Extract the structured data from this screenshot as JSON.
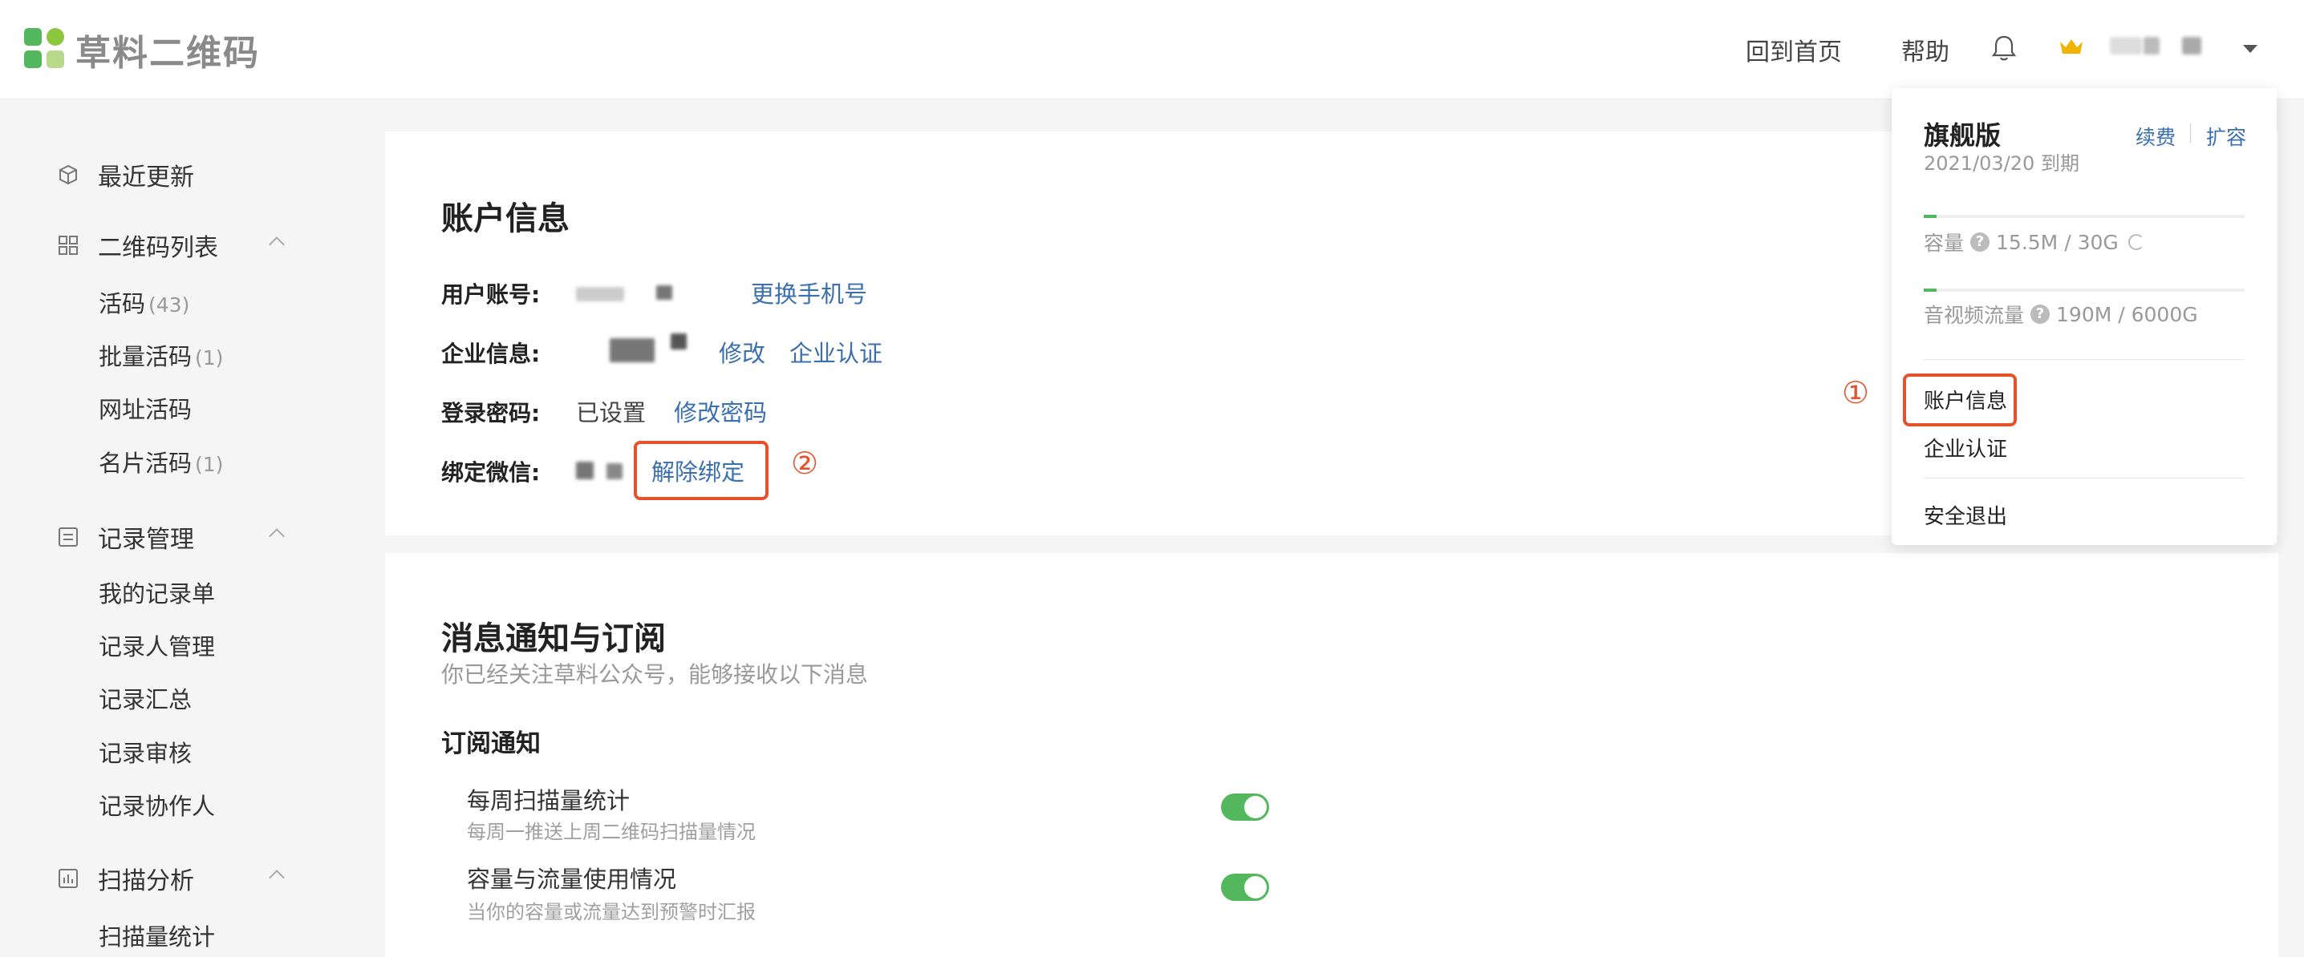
{
  "header": {
    "logo_text": "草料二维码",
    "nav": [
      "回到首页",
      "帮助"
    ],
    "icons": [
      "bell-icon",
      "crown-icon",
      "caret-down-icon"
    ]
  },
  "sidebar": {
    "groups": [
      {
        "label": "最近更新",
        "icon": "cube-icon"
      },
      {
        "label": "二维码列表",
        "icon": "grid-icon",
        "items": [
          {
            "label": "活码",
            "count": "(43)"
          },
          {
            "label": "批量活码",
            "count": "(1)"
          },
          {
            "label": "网址活码",
            "count": ""
          },
          {
            "label": "名片活码",
            "count": "(1)"
          }
        ]
      },
      {
        "label": "记录管理",
        "icon": "form-icon",
        "items": [
          {
            "label": "我的记录单"
          },
          {
            "label": "记录人管理"
          },
          {
            "label": "记录汇总"
          },
          {
            "label": "记录审核"
          },
          {
            "label": "记录协作人"
          }
        ]
      },
      {
        "label": "扫描分析",
        "icon": "chart-icon",
        "items": [
          {
            "label": "扫描量统计"
          }
        ]
      }
    ]
  },
  "account": {
    "title": "账户信息",
    "rows": [
      {
        "label": "用户账号:",
        "value": "",
        "actions": [
          "更换手机号"
        ]
      },
      {
        "label": "企业信息:",
        "value": "",
        "actions": [
          "修改",
          "企业认证"
        ]
      },
      {
        "label": "登录密码:",
        "value": "已设置",
        "actions": [
          "修改密码"
        ]
      },
      {
        "label": "绑定微信:",
        "value": "",
        "actions": [
          "解除绑定"
        ]
      }
    ],
    "step_marker": "②"
  },
  "notify": {
    "title": "消息通知与订阅",
    "subtitle": "你已经关注草料公众号，能够接收以下消息",
    "section": "订阅通知",
    "items": [
      {
        "title": "每周扫描量统计",
        "desc": "每周一推送上周二维码扫描量情况",
        "on": true
      },
      {
        "title": "容量与流量使用情况",
        "desc": "当你的容量或流量达到预警时汇报",
        "on": true
      }
    ]
  },
  "dropdown": {
    "plan": "旗舰版",
    "expire": "2021/03/20 到期",
    "renew": "续费",
    "expand": "扩容",
    "storage_label": "容量",
    "storage_value": "15.5M / 30G",
    "storage_fraction": 0.0005,
    "traffic_label": "音视频流量",
    "traffic_value": "190M / 6000G",
    "traffic_fraction": 3e-05,
    "menu": [
      "账户信息",
      "企业认证",
      "安全退出"
    ],
    "step_marker": "①"
  },
  "colors": {
    "accent_link": "#3a6fb0",
    "highlight": "#e5512a",
    "toggle_on": "#52b75d",
    "logo_green": "#52b75d"
  }
}
